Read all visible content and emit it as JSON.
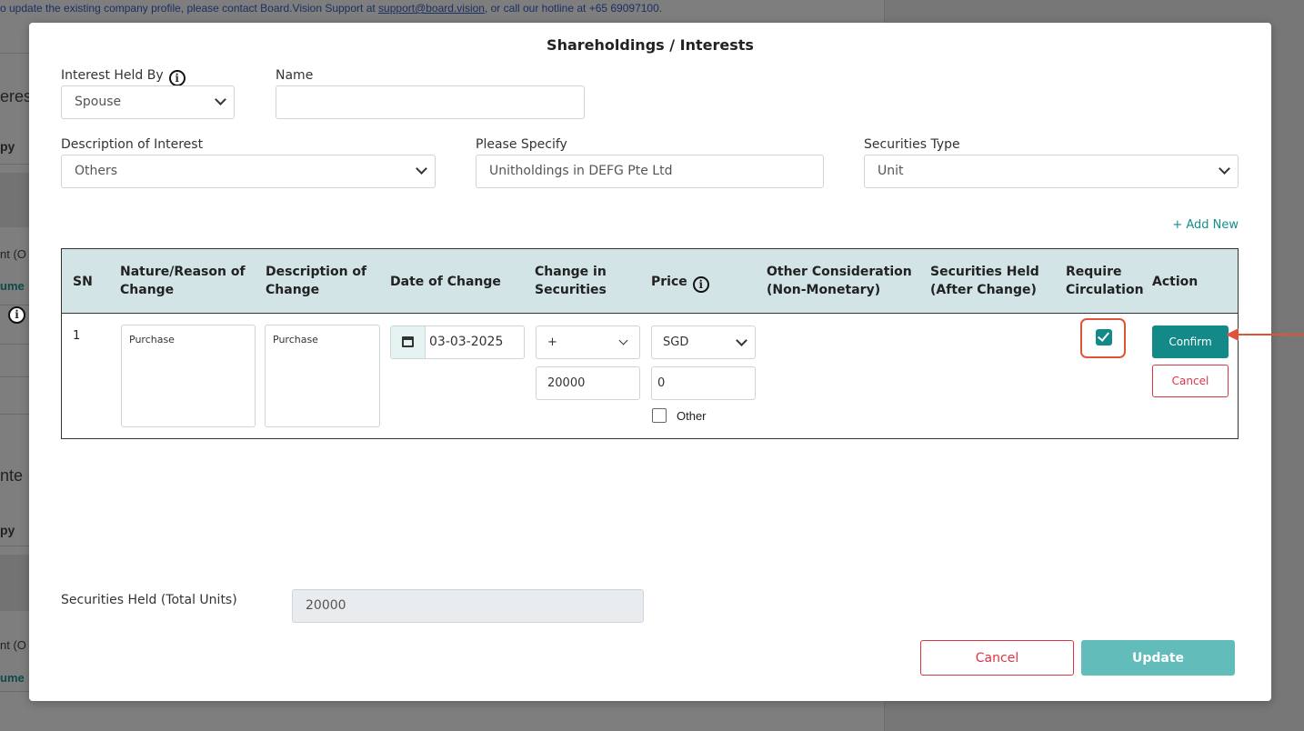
{
  "background": {
    "notice_prefix": "o update the existing company profile, please contact Board.Vision Support at ",
    "notice_email": "support@board.vision",
    "notice_suffix": ", or call our hotline at +65 69097100.",
    "fragments": [
      "eres",
      "py",
      "nt (O",
      "ume",
      "nte",
      "py",
      "nt (O",
      "ume"
    ]
  },
  "modal": {
    "title": "Shareholdings / Interests",
    "interest_held_by": {
      "label": "Interest Held By",
      "value": "Spouse"
    },
    "name": {
      "label": "Name",
      "value": ""
    },
    "description_of_interest": {
      "label": "Description of Interest",
      "value": "Others"
    },
    "please_specify": {
      "label": "Please Specify",
      "value": "Unitholdings in DEFG Pte Ltd"
    },
    "securities_type": {
      "label": "Securities Type",
      "value": "Unit"
    },
    "add_new": "+ Add New",
    "table": {
      "headers": {
        "sn": "SN",
        "nature_1": "Nature/Reason of",
        "nature_2": "Change",
        "desc_1": "Description of",
        "desc_2": "Change",
        "date": "Date of Change",
        "change_1": "Change in",
        "change_2": "Securities",
        "price": "Price",
        "other_1": "Other Consideration",
        "other_2": "(Non-Monetary)",
        "held_1": "Securities Held",
        "held_2": "(After Change)",
        "req_1": "Require",
        "req_2": "Circulation",
        "action": "Action"
      },
      "row": {
        "sn": "1",
        "nature": "Purchase",
        "description": "Purchase",
        "date": "03-03-2025",
        "sign": "+",
        "change_amount": "20000",
        "currency": "SGD",
        "price": "0",
        "other_label": "Other",
        "require_circulation": true,
        "confirm_label": "Confirm",
        "cancel_label": "Cancel"
      }
    },
    "total": {
      "label": "Securities Held (Total Units)",
      "value": "20000"
    },
    "footer": {
      "cancel_label": "Cancel",
      "update_label": "Update"
    }
  },
  "colors": {
    "accent": "#138a87",
    "update": "#62bcb9",
    "danger": "#dc3545",
    "highlight": "#e0533b"
  }
}
